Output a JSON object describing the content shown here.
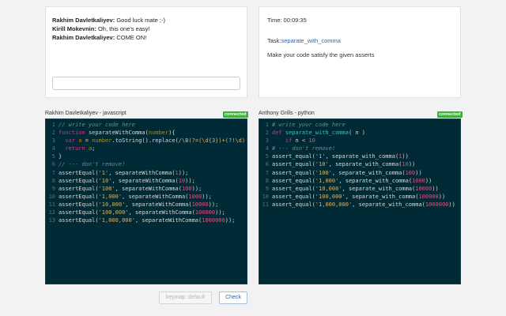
{
  "chat": {
    "messages": [
      {
        "author": "Rakhim Davletkaliyev:",
        "text": "Good luck mate ;-)"
      },
      {
        "author": "Kirill Mokevnin:",
        "text": "Oh, this one's easy!"
      },
      {
        "author": "Rakhim Davletkaliyev:",
        "text": "COME ON!"
      }
    ],
    "input_value": ""
  },
  "task": {
    "time_label": "Time: 00:09:35",
    "task_prefix": "Task:",
    "task_link": "separate_with_comma",
    "description": "Make your code satisfy the given asserts"
  },
  "left_editor": {
    "header": "Rakhim Davletkaliyev - javascript",
    "status": "connected",
    "lines": [
      [
        [
          "c",
          "// write your code here"
        ]
      ],
      [
        [
          "k",
          "function "
        ],
        [
          "f",
          "separateWithComma"
        ],
        [
          "t",
          "("
        ],
        [
          "v",
          "number"
        ],
        [
          "t",
          "){"
        ]
      ],
      [
        [
          "t",
          "  "
        ],
        [
          "k",
          "var "
        ],
        [
          "v",
          "a"
        ],
        [
          "t",
          " = "
        ],
        [
          "v",
          "number"
        ],
        [
          "t",
          "."
        ],
        [
          "f",
          "toString"
        ],
        [
          "t",
          "()."
        ],
        [
          "f",
          "replace"
        ],
        [
          "t",
          "("
        ],
        [
          "s",
          "/\\B(?=(\\d{3})+(?!\\d)"
        ]
      ],
      [
        [
          "t",
          "  "
        ],
        [
          "k",
          "return "
        ],
        [
          "v",
          "a"
        ],
        [
          "t",
          ";"
        ]
      ],
      [
        [
          "t",
          "}"
        ]
      ],
      [
        [
          "c",
          "// --- don't remove!"
        ]
      ],
      [
        [
          "t",
          "assertEqual("
        ],
        [
          "s",
          "'1'"
        ],
        [
          "t",
          ", separateWithComma("
        ],
        [
          "n",
          "1"
        ],
        [
          "t",
          "));"
        ]
      ],
      [
        [
          "t",
          "assertEqual("
        ],
        [
          "s",
          "'10'"
        ],
        [
          "t",
          ", separateWithComma("
        ],
        [
          "n",
          "10"
        ],
        [
          "t",
          "));"
        ]
      ],
      [
        [
          "t",
          "assertEqual("
        ],
        [
          "s",
          "'100'"
        ],
        [
          "t",
          ", separateWithComma("
        ],
        [
          "n",
          "100"
        ],
        [
          "t",
          "));"
        ]
      ],
      [
        [
          "t",
          "assertEqual("
        ],
        [
          "s",
          "'1,000'"
        ],
        [
          "t",
          ", separateWithComma("
        ],
        [
          "n",
          "1000"
        ],
        [
          "t",
          "));"
        ]
      ],
      [
        [
          "t",
          "assertEqual("
        ],
        [
          "s",
          "'10,000'"
        ],
        [
          "t",
          ", separateWithComma("
        ],
        [
          "n",
          "10000"
        ],
        [
          "t",
          "));"
        ]
      ],
      [
        [
          "t",
          "assertEqual("
        ],
        [
          "s",
          "'100,000'"
        ],
        [
          "t",
          ", separateWithComma("
        ],
        [
          "n",
          "100000"
        ],
        [
          "t",
          "));"
        ]
      ],
      [
        [
          "t",
          "assertEqual("
        ],
        [
          "s",
          "'1,000,000'"
        ],
        [
          "t",
          ", separateWithComma("
        ],
        [
          "n",
          "1000000"
        ],
        [
          "t",
          "));"
        ]
      ]
    ]
  },
  "right_editor": {
    "header": "Anthony Grills - python",
    "status": "connected",
    "lines": [
      [
        [
          "c",
          "# write your code here"
        ]
      ],
      [
        [
          "k",
          "def "
        ],
        [
          "fn",
          "separate_with_comma"
        ],
        [
          "t",
          "( n )"
        ]
      ],
      [
        [
          "t",
          "    "
        ],
        [
          "k",
          "if "
        ],
        [
          "t",
          "n < "
        ],
        [
          "n",
          "10"
        ]
      ],
      [
        [
          "c",
          "# --- don't remove!"
        ]
      ],
      [
        [
          "t",
          "assert_equal("
        ],
        [
          "s",
          "'1'"
        ],
        [
          "t",
          ", separate_with_comma("
        ],
        [
          "n",
          "1"
        ],
        [
          "t",
          "))"
        ]
      ],
      [
        [
          "t",
          "assert_equal("
        ],
        [
          "s",
          "'10'"
        ],
        [
          "t",
          ", separate_with_comma("
        ],
        [
          "n",
          "10"
        ],
        [
          "t",
          "))"
        ]
      ],
      [
        [
          "t",
          "assert_equal("
        ],
        [
          "s",
          "'100'"
        ],
        [
          "t",
          ", separate_with_comma("
        ],
        [
          "n",
          "100"
        ],
        [
          "t",
          "))"
        ]
      ],
      [
        [
          "t",
          "assert_equal("
        ],
        [
          "s",
          "'1,000'"
        ],
        [
          "t",
          ", separate_with_comma("
        ],
        [
          "n",
          "1000"
        ],
        [
          "t",
          "))"
        ]
      ],
      [
        [
          "t",
          "assert_equal("
        ],
        [
          "s",
          "'10,000'"
        ],
        [
          "t",
          ", separate_with_comma("
        ],
        [
          "n",
          "10000"
        ],
        [
          "t",
          "))"
        ]
      ],
      [
        [
          "t",
          "assert_equal("
        ],
        [
          "s",
          "'100,000'"
        ],
        [
          "t",
          ", separate_with_comma("
        ],
        [
          "n",
          "100000"
        ],
        [
          "t",
          "))"
        ]
      ],
      [
        [
          "t",
          "assert_equal("
        ],
        [
          "s",
          "'1,000,000'"
        ],
        [
          "t",
          ", separate_with_comma("
        ],
        [
          "n",
          "1000000"
        ],
        [
          "t",
          "))"
        ]
      ]
    ]
  },
  "toolbar": {
    "keymap_label": "keymap: default",
    "check_label": "Check"
  }
}
